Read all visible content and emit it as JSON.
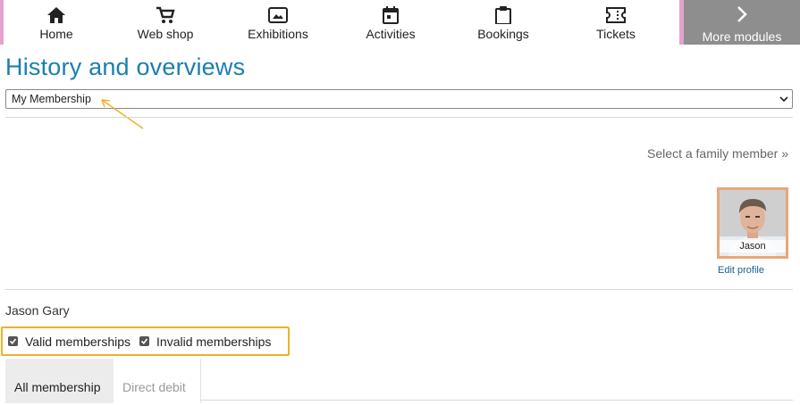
{
  "nav": {
    "items": [
      {
        "label": "Home",
        "icon": "home-icon"
      },
      {
        "label": "Web shop",
        "icon": "cart-icon"
      },
      {
        "label": "Exhibitions",
        "icon": "image-icon"
      },
      {
        "label": "Activities",
        "icon": "calendar-icon"
      },
      {
        "label": "Bookings",
        "icon": "clipboard-icon"
      },
      {
        "label": "Tickets",
        "icon": "ticket-icon"
      }
    ],
    "more": {
      "label": "More modules",
      "icon": "chevron-right-icon"
    }
  },
  "page": {
    "title": "History and overviews"
  },
  "select": {
    "value": "My Membership"
  },
  "family": {
    "link": "Select a family member »"
  },
  "profile": {
    "name": "Jason",
    "edit": "Edit profile"
  },
  "member": {
    "full_name": "Jason Gary"
  },
  "filters": [
    {
      "label": "Valid memberships",
      "checked": true
    },
    {
      "label": "Invalid memberships",
      "checked": true
    }
  ],
  "tabs": [
    {
      "label": "All membership",
      "active": true
    },
    {
      "label": "Direct debit",
      "active": false
    }
  ],
  "colors": {
    "accent": "#1a7fae",
    "highlight": "#f0b02a",
    "avatar_border": "#e8a77a",
    "nav_more_bg": "#8e8e8e",
    "nav_edge": "#e2a3cf"
  }
}
